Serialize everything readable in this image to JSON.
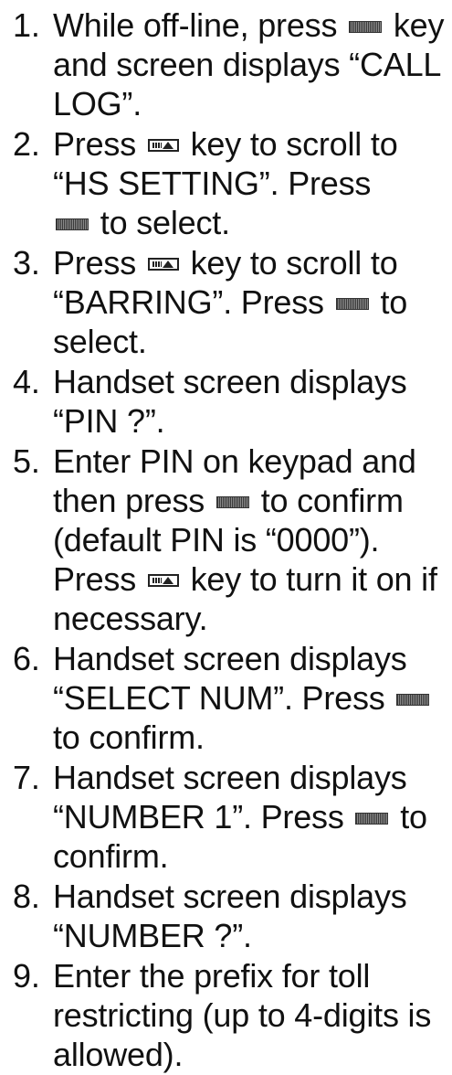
{
  "steps": [
    {
      "number": "1.",
      "parts": [
        "While off-line, press ",
        " key and screen displays “CALL LOG”."
      ]
    },
    {
      "number": "2.",
      "parts": [
        "Press ",
        " key to scroll to “HS SETTING”.  Press ",
        " to select."
      ]
    },
    {
      "number": "3.",
      "parts": [
        "Press ",
        " key to scroll to “BARRING”.  Press ",
        " to select."
      ]
    },
    {
      "number": "4.",
      "parts": [
        "Handset screen displays “PIN ?”."
      ]
    },
    {
      "number": "5.",
      "parts": [
        "Enter PIN on keypad and then press ",
        " to confirm (default PIN is “0000”).  Press ",
        " key to turn it on if necessary."
      ]
    },
    {
      "number": "6.",
      "parts": [
        "Handset screen displays “SELECT NUM”.  Press ",
        " to confirm."
      ]
    },
    {
      "number": "7.",
      "parts": [
        "Handset screen displays “NUMBER 1”.  Press ",
        " to confirm."
      ]
    },
    {
      "number": "8.",
      "parts": [
        "Handset screen displays “NUMBER ?”."
      ]
    },
    {
      "number": "9.",
      "parts": [
        "Enter the prefix for toll restricting (up to 4-digits is allowed)."
      ]
    }
  ],
  "icons": {
    "menu_key": "menu-ok-key-icon",
    "ta_key": "t-up-key-icon"
  }
}
